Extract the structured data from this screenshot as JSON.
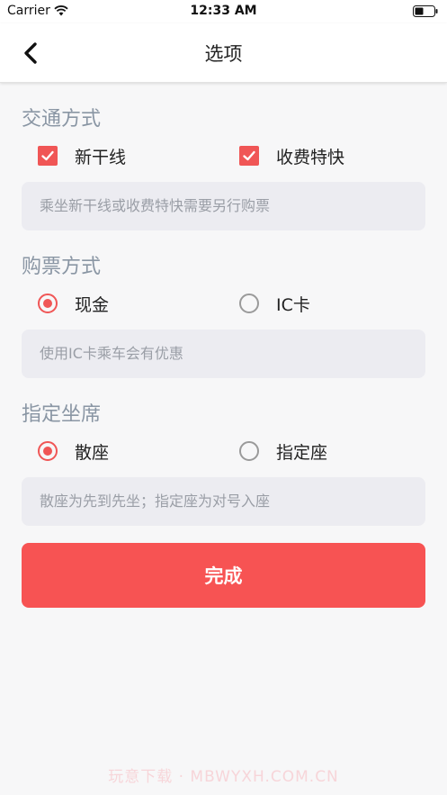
{
  "status_bar": {
    "carrier": "Carrier",
    "time": "12:33 AM",
    "wifi_icon": "wifi-icon",
    "battery_icon": "battery-icon"
  },
  "nav": {
    "title": "选项",
    "back_icon": "chevron-left-icon"
  },
  "transport": {
    "title": "交通方式",
    "options": [
      {
        "label": "新干线",
        "checked": true
      },
      {
        "label": "收费特快",
        "checked": true
      }
    ],
    "note": "乘坐新干线或收费特快需要另行购票"
  },
  "ticket": {
    "title": "购票方式",
    "options": [
      {
        "label": "现金",
        "selected": true
      },
      {
        "label": "IC卡",
        "selected": false
      }
    ],
    "note": "使用IC卡乘车会有优惠"
  },
  "seat": {
    "title": "指定坐席",
    "options": [
      {
        "label": "散座",
        "selected": true
      },
      {
        "label": "指定座",
        "selected": false
      }
    ],
    "note": "散座为先到先坐；指定座为对号入座"
  },
  "done_label": "完成",
  "watermark": "玩意下载 · MBWYXH.COM.CN",
  "colors": {
    "accent": "#f05656",
    "button": "#f75353",
    "section_title": "#8a96a4",
    "note_bg": "#ececf1"
  }
}
